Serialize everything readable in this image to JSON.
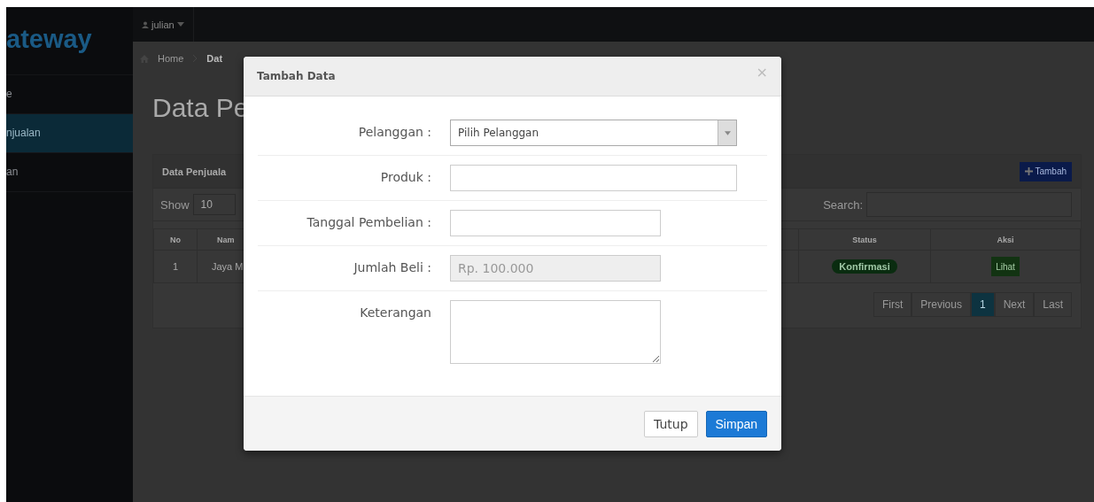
{
  "sidebar": {
    "brand": "ateway",
    "items": [
      {
        "label": "e",
        "selected": false
      },
      {
        "label": "njualan",
        "selected": true
      },
      {
        "label": "an",
        "selected": false
      }
    ]
  },
  "topbar": {
    "user": "julian"
  },
  "breadcrumb": [
    "Home",
    "Dat"
  ],
  "page_title": "Data Pe",
  "panel": {
    "title": "Data Penjuala",
    "add_button": "Tambah",
    "show_label": "Show",
    "page_size": "10",
    "search_label": "Search:",
    "table": {
      "columns": [
        "No",
        "Nam",
        "Status",
        "Aksi"
      ],
      "rows": [
        {
          "no": "1",
          "name": "Jaya M",
          "status": "Konfirmasi",
          "action": "Lihat"
        }
      ]
    },
    "pagination": [
      {
        "label": "First",
        "selected": false
      },
      {
        "label": "Previous",
        "selected": false
      },
      {
        "label": "1",
        "selected": true
      },
      {
        "label": "Next",
        "selected": false
      },
      {
        "label": "Last",
        "selected": false
      }
    ]
  },
  "modal": {
    "title": "Tambah Data",
    "close": "×",
    "fields": [
      {
        "kind": "select",
        "label": "Pelanggan :",
        "value": "Pilih Pelanggan"
      },
      {
        "kind": "text",
        "label": "Produk :"
      },
      {
        "kind": "short",
        "label": "Tanggal Pembelian :"
      },
      {
        "kind": "readonly",
        "label": "Jumlah Beli :",
        "value": "Rp. 100.000"
      },
      {
        "kind": "textarea",
        "label": "Keterangan"
      }
    ],
    "buttons": [
      {
        "label": "Tutup",
        "kind": "default"
      },
      {
        "label": "Simpan",
        "kind": "primary"
      }
    ]
  }
}
